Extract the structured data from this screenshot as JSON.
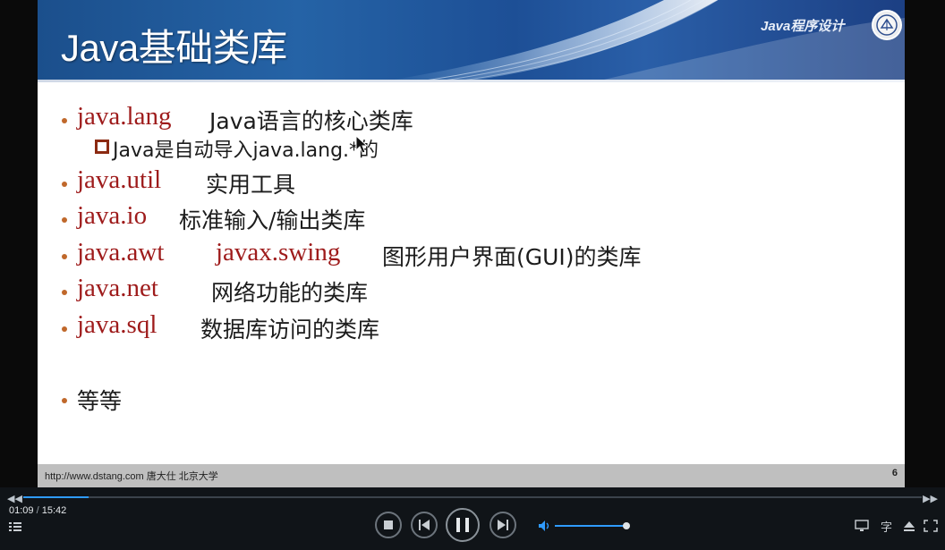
{
  "slide": {
    "title": "Java基础类库",
    "course": "Java程序设计",
    "items": [
      {
        "pkg": "java.lang",
        "desc": "Java语言的核心类库"
      },
      {
        "pkg": "java.util",
        "desc": "实用工具"
      },
      {
        "pkg": "java.io",
        "desc": "标准输入/输出类库"
      },
      {
        "pkg": "java.awt",
        "pkg2": "javax.swing",
        "desc": "图形用户界面(GUI)的类库"
      },
      {
        "pkg": "java.net",
        "desc": "网络功能的类库"
      },
      {
        "pkg": "java.sql",
        "desc": "数据库访问的类库"
      },
      {
        "pkg": "",
        "desc": "等等"
      }
    ],
    "sub_item": "Java是自动导入java.lang.*的",
    "footer_url": "http://www.dstang.com 唐大仕 北京大学",
    "page_number": "6"
  },
  "player": {
    "current_time": "01:09",
    "separator": "/",
    "total_time": "15:42",
    "progress_fraction": 0.073,
    "volume_fraction": 1.0,
    "seek_back_icon": "skip-back-icon",
    "seek_forward_icon": "skip-forward-icon",
    "subtitle_label": "字"
  },
  "colors": {
    "accent": "#2f9bff",
    "package_red": "#9e1b1b",
    "bullet_orange": "#c0682b",
    "banner_blue": "#2563a6"
  }
}
